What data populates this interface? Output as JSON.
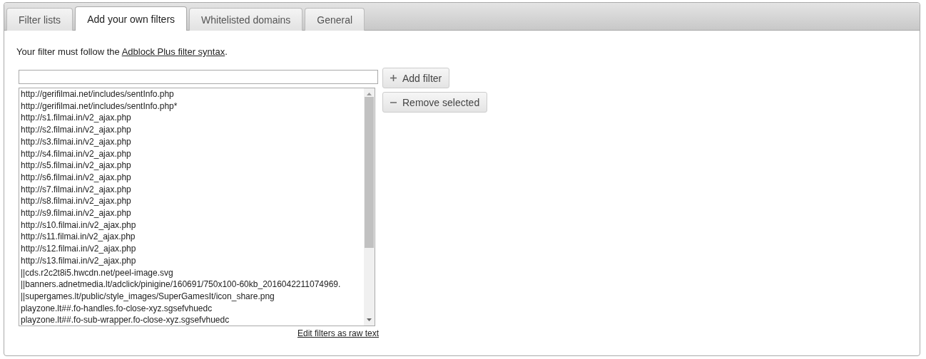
{
  "tabs": [
    {
      "label": "Filter lists",
      "selected": false
    },
    {
      "label": "Add your own filters",
      "selected": true
    },
    {
      "label": "Whitelisted domains",
      "selected": false
    },
    {
      "label": "General",
      "selected": false
    }
  ],
  "intro": {
    "text": "Your filter must follow the ",
    "link": "Adblock Plus filter syntax",
    "after": "."
  },
  "buttons": [
    {
      "label": "Add filter",
      "kind": "add"
    },
    {
      "label": "Remove selected",
      "kind": "remove"
    }
  ],
  "filters": [
    {
      "text": "http://gerifilmai.net/includes/sentInfo.php",
      "selected": false
    },
    {
      "text": "http://gerifilmai.net/includes/sentInfo.php*",
      "selected": false
    },
    {
      "text": "http://s1.filmai.in/v2_ajax.php",
      "selected": false
    },
    {
      "text": "http://s2.filmai.in/v2_ajax.php",
      "selected": false
    },
    {
      "text": "http://s3.filmai.in/v2_ajax.php",
      "selected": false
    },
    {
      "text": "http://s4.filmai.in/v2_ajax.php",
      "selected": false
    },
    {
      "text": "http://s5.filmai.in/v2_ajax.php",
      "selected": false
    },
    {
      "text": "http://s6.filmai.in/v2_ajax.php",
      "selected": false
    },
    {
      "text": "http://s7.filmai.in/v2_ajax.php",
      "selected": false
    },
    {
      "text": "http://s8.filmai.in/v2_ajax.php",
      "selected": false
    },
    {
      "text": "http://s9.filmai.in/v2_ajax.php",
      "selected": false
    },
    {
      "text": "http://s10.filmai.in/v2_ajax.php",
      "selected": false
    },
    {
      "text": "http://s11.filmai.in/v2_ajax.php",
      "selected": false
    },
    {
      "text": "http://s12.filmai.in/v2_ajax.php",
      "selected": false
    },
    {
      "text": "http://s13.filmai.in/v2_ajax.php",
      "selected": false
    },
    {
      "text": "||cds.r2c2t8i5.hwcdn.net/peel-image.svg",
      "selected": false
    },
    {
      "text": "||banners.adnetmedia.lt/adclick/pinigine/160691/750x100-60kb_2016042211074969.",
      "selected": false
    },
    {
      "text": "||supergames.lt/public/style_images/SuperGamesIt/icon_share.png",
      "selected": false
    },
    {
      "text": "playzone.lt##.fo-handles.fo-close-xyz.sgsefvhuedc",
      "selected": false
    },
    {
      "text": "playzone.lt##.fo-sub-wrapper.fo-close-xyz.sgsefvhuedc",
      "selected": false
    }
  ],
  "raw_link": "Edit filters as raw text"
}
